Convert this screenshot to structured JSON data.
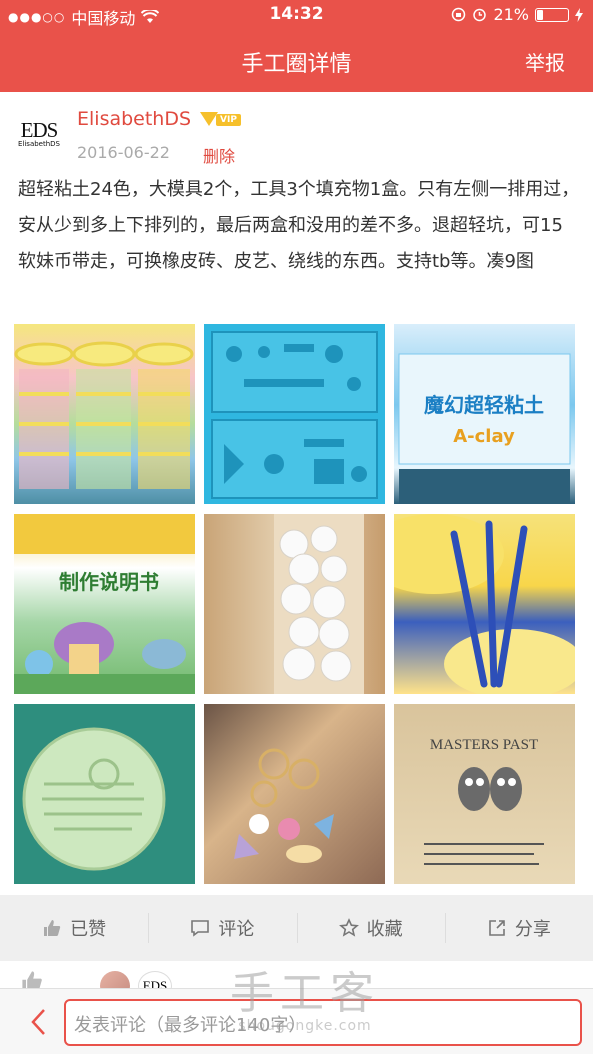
{
  "status_bar": {
    "carrier": "中国移动",
    "time": "14:32",
    "battery": "21%",
    "battery_level": 0.21
  },
  "nav": {
    "title": "手工圈详情",
    "report": "举报"
  },
  "post": {
    "avatar_logo": "EDS",
    "avatar_sub": "ElisabethDS",
    "username": "ElisabethDS",
    "vip_badge": "VIP",
    "date": "2016-06-22",
    "delete": "删除",
    "description": "超轻粘土24色，大模具2个，工具3个填充物1盒。只有左侧一排用过，安从少到多上下排列的，最后两盒和没用的差不多。退超轻坑，可15软妹币带走，可换橡皮砖、皮艺、绕线的东西。支持tb等。凑9图",
    "photos": [
      {
        "name": "photo-clay-tubs"
      },
      {
        "name": "photo-blue-mold"
      },
      {
        "name": "photo-clay-box",
        "text": "魔幻超轻粘土",
        "text2": "A-clay"
      },
      {
        "name": "photo-instruction-sheet",
        "text": "制作说明书"
      },
      {
        "name": "photo-foam-balls"
      },
      {
        "name": "photo-blue-tools"
      },
      {
        "name": "photo-green-stamp"
      },
      {
        "name": "photo-charms"
      },
      {
        "name": "photo-cat-stamp",
        "text": "MASTERS PAST"
      }
    ]
  },
  "actions": {
    "liked": "已赞",
    "comment": "评论",
    "favorite": "收藏",
    "share": "分享"
  },
  "likers": {
    "avatar_text": "EDS"
  },
  "comment_input": {
    "placeholder": "发表评论（最多评论140字）"
  },
  "watermark": {
    "line1": "手工客",
    "line2": "shougongke.com"
  },
  "colors": {
    "brand": "#e9524a",
    "username": "#e04a3f",
    "vip": "#f6c02b"
  }
}
